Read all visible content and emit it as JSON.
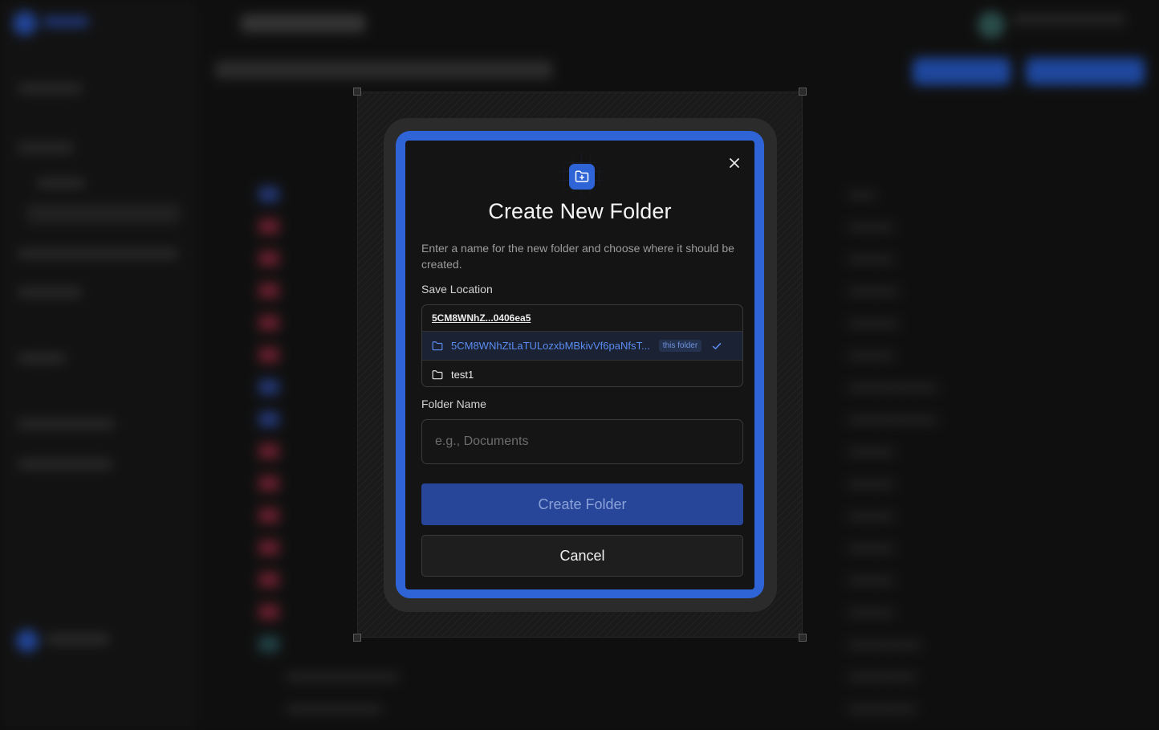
{
  "dialog": {
    "title": "Create New Folder",
    "description": "Enter a name for the new folder and choose where it should be created.",
    "save_location_label": "Save Location",
    "location": {
      "root": "5CM8WNhZ...0406ea5",
      "items": [
        {
          "name": "5CM8WNhZtLaTULozxbMBkivVf6paNfsT...",
          "tag": "this folder",
          "selected": true
        },
        {
          "name": "test1",
          "selected": false
        }
      ]
    },
    "folder_name_label": "Folder Name",
    "folder_name_placeholder": "e.g., Documents",
    "folder_name_value": "",
    "create_button": "Create Folder",
    "cancel_button": "Cancel"
  },
  "icons": {
    "header": "folder-plus-icon",
    "close": "close-icon",
    "folder": "folder-icon",
    "selected": "check-icon"
  },
  "colors": {
    "accent": "#2f64d6",
    "selected_text": "#5b8cf0",
    "primary_button": "#27469a"
  }
}
